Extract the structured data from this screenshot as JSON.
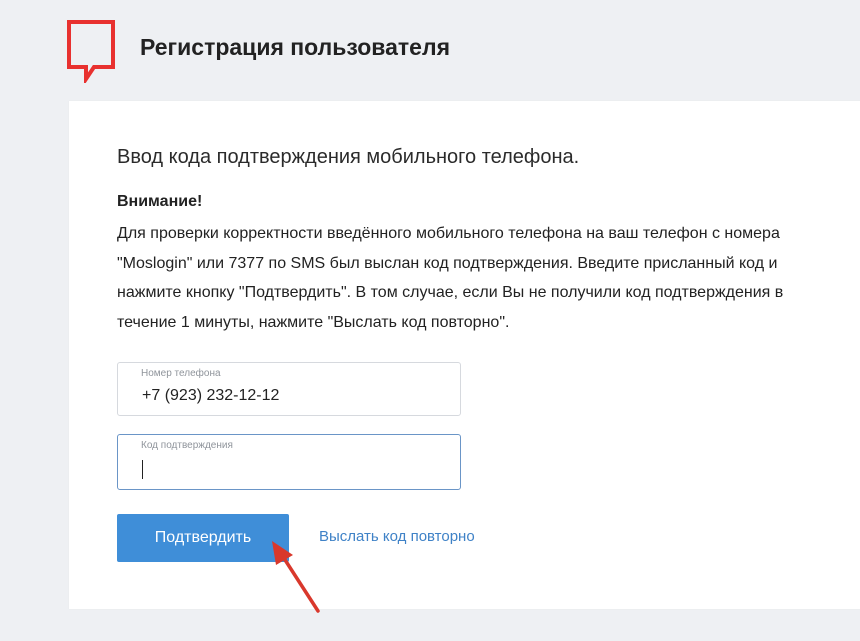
{
  "header": {
    "title": "Регистрация пользователя"
  },
  "card": {
    "section_title": "Ввод кода подтверждения мобильного телефона.",
    "warning_title": "Внимание!",
    "warning_text": "Для проверки корректности введённого мобильного телефона на ваш телефон с номера \"Moslogin\" или 7377 по SMS был выслан код подтверждения. Введите присланный код и нажмите кнопку \"Подтвердить\". В том случае, если Вы не получили код подтверждения в течение 1 минуты, нажмите \"Выслать код повторно\".",
    "phone_field": {
      "label": "Номер телефона",
      "value": "+7 (923) 232-12-12"
    },
    "code_field": {
      "label": "Код подтверждения",
      "value": ""
    },
    "confirm_button": "Подтвердить",
    "resend_link": "Выслать код повторно"
  },
  "colors": {
    "logo_red": "#e8312f",
    "button_blue": "#3f8ed8",
    "link_blue": "#3f82c7",
    "focus_border": "#6a95c7",
    "background": "#eef0f3",
    "arrow_red": "#d9382c"
  },
  "icons": {
    "logo": "speech-bubble-logo-icon",
    "annotation": "red-arrow-icon"
  }
}
